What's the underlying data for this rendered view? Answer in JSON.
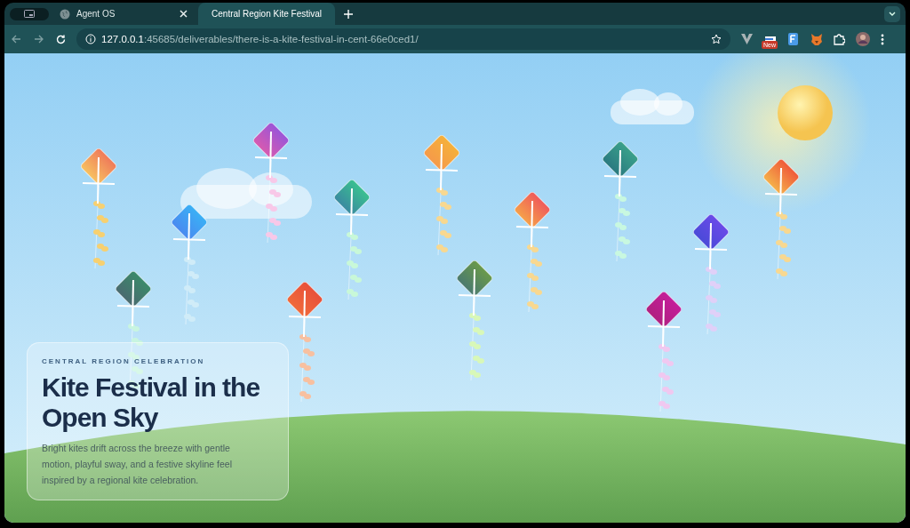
{
  "browser": {
    "tabs": [
      {
        "title": "Agent OS",
        "selected": false
      },
      {
        "title": "Central Region Kite Festival",
        "selected": true
      }
    ],
    "address": "**127.0.0.1**:45685/deliverables/there-is-a-kite-festival-in-cent-66e0ced1/",
    "extension_badge": "New"
  },
  "hero": {
    "eyebrow": "CENTRAL REGION CELEBRATION",
    "title": "Kite Festival in the Open Sky",
    "body": "Bright kites drift across the breeze with gentle motion, playful sway, and a festive skyline feel inspired by a regional kite celebration."
  }
}
